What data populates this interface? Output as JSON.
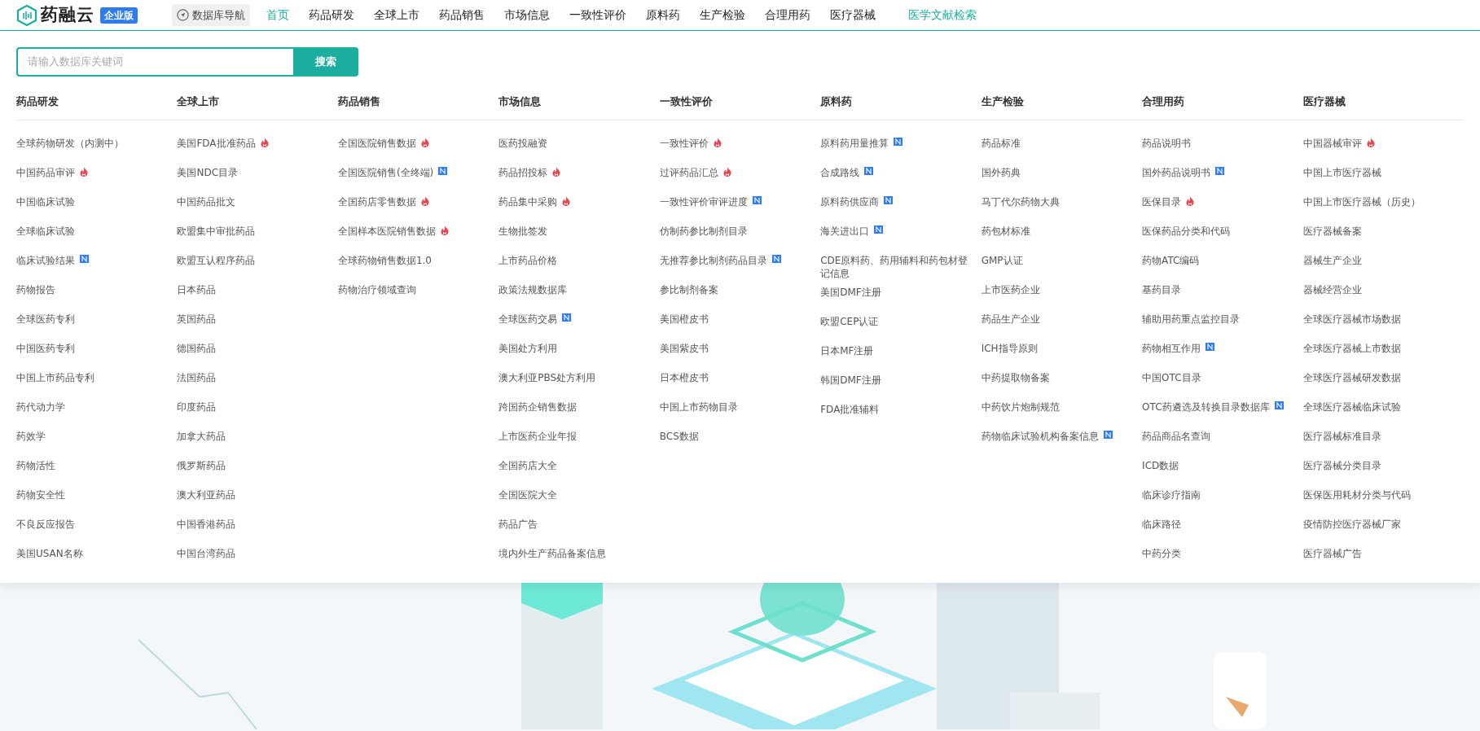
{
  "header": {
    "logo_text": "药融云",
    "edition_badge": "企业版",
    "db_nav_button": "数据库导航",
    "nav": [
      {
        "label": "首页",
        "selected": true
      },
      {
        "label": "药品研发",
        "selected": false
      },
      {
        "label": "全球上市",
        "selected": false
      },
      {
        "label": "药品销售",
        "selected": false
      },
      {
        "label": "市场信息",
        "selected": false
      },
      {
        "label": "一致性评价",
        "selected": false
      },
      {
        "label": "原料药",
        "selected": false
      },
      {
        "label": "生产检验",
        "selected": false
      },
      {
        "label": "合理用药",
        "selected": false
      },
      {
        "label": "医疗器械",
        "selected": false
      }
    ],
    "literature_link": "医学文献检索"
  },
  "search": {
    "placeholder": "请输入数据库关键词",
    "button": "搜索"
  },
  "menu": [
    {
      "title": "药品研发",
      "items": [
        {
          "label": "全球药物研发（内测中）",
          "kind": "plain"
        },
        {
          "label": "中国药品审评",
          "kind": "hot"
        },
        {
          "label": "中国临床试验",
          "kind": "plain"
        },
        {
          "label": "全球临床试验",
          "kind": "plain"
        },
        {
          "label": "临床试验结果",
          "kind": "new"
        },
        {
          "label": "药物报告",
          "kind": "plain"
        },
        {
          "label": "全球医药专利",
          "kind": "plain"
        },
        {
          "label": "中国医药专利",
          "kind": "plain"
        },
        {
          "label": "中国上市药品专利",
          "kind": "plain"
        },
        {
          "label": "药代动力学",
          "kind": "plain"
        },
        {
          "label": "药效学",
          "kind": "plain"
        },
        {
          "label": "药物活性",
          "kind": "plain"
        },
        {
          "label": "药物安全性",
          "kind": "plain"
        },
        {
          "label": "不良反应报告",
          "kind": "plain"
        },
        {
          "label": "美国USAN名称",
          "kind": "plain"
        }
      ]
    },
    {
      "title": "全球上市",
      "items": [
        {
          "label": "美国FDA批准药品",
          "kind": "hot"
        },
        {
          "label": "美国NDC目录",
          "kind": "plain"
        },
        {
          "label": "中国药品批文",
          "kind": "plain"
        },
        {
          "label": "欧盟集中审批药品",
          "kind": "plain"
        },
        {
          "label": "欧盟互认程序药品",
          "kind": "plain"
        },
        {
          "label": "日本药品",
          "kind": "plain"
        },
        {
          "label": "英国药品",
          "kind": "plain"
        },
        {
          "label": "德国药品",
          "kind": "plain"
        },
        {
          "label": "法国药品",
          "kind": "plain"
        },
        {
          "label": "印度药品",
          "kind": "plain"
        },
        {
          "label": "加拿大药品",
          "kind": "plain"
        },
        {
          "label": "俄罗斯药品",
          "kind": "plain"
        },
        {
          "label": "澳大利亚药品",
          "kind": "plain"
        },
        {
          "label": "中国香港药品",
          "kind": "plain"
        },
        {
          "label": "中国台湾药品",
          "kind": "plain"
        }
      ]
    },
    {
      "title": "药品销售",
      "items": [
        {
          "label": "全国医院销售数据",
          "kind": "hot"
        },
        {
          "label": "全国医院销售(全终端)",
          "kind": "new"
        },
        {
          "label": "全国药店零售数据",
          "kind": "hot"
        },
        {
          "label": "全国样本医院销售数据",
          "kind": "hot"
        },
        {
          "label": "全球药物销售数据1.0",
          "kind": "plain"
        },
        {
          "label": "药物治疗领域查询",
          "kind": "plain"
        }
      ]
    },
    {
      "title": "市场信息",
      "items": [
        {
          "label": "医药投融资",
          "kind": "plain"
        },
        {
          "label": "药品招投标",
          "kind": "hot"
        },
        {
          "label": "药品集中采购",
          "kind": "hot"
        },
        {
          "label": "生物批签发",
          "kind": "plain"
        },
        {
          "label": "上市药品价格",
          "kind": "plain"
        },
        {
          "label": "政策法规数据库",
          "kind": "plain"
        },
        {
          "label": "全球医药交易",
          "kind": "new"
        },
        {
          "label": "美国处方利用",
          "kind": "plain"
        },
        {
          "label": "澳大利亚PBS处方利用",
          "kind": "plain"
        },
        {
          "label": "跨国药企销售数据",
          "kind": "plain"
        },
        {
          "label": "上市医药企业年报",
          "kind": "plain"
        },
        {
          "label": "全国药店大全",
          "kind": "plain"
        },
        {
          "label": "全国医院大全",
          "kind": "plain"
        },
        {
          "label": "药品广告",
          "kind": "plain"
        },
        {
          "label": "境内外生产药品备案信息",
          "kind": "plain"
        }
      ]
    },
    {
      "title": "一致性评价",
      "items": [
        {
          "label": "一致性评价",
          "kind": "hot"
        },
        {
          "label": "过评药品汇总",
          "kind": "hot"
        },
        {
          "label": "一致性评价审评进度",
          "kind": "new"
        },
        {
          "label": "仿制药参比制剂目录",
          "kind": "plain"
        },
        {
          "label": "无推荐参比制剂药品目录",
          "kind": "new"
        },
        {
          "label": "参比制剂备案",
          "kind": "plain"
        },
        {
          "label": "美国橙皮书",
          "kind": "plain"
        },
        {
          "label": "美国紫皮书",
          "kind": "plain"
        },
        {
          "label": "日本橙皮书",
          "kind": "plain"
        },
        {
          "label": "中国上市药物目录",
          "kind": "plain"
        },
        {
          "label": "BCS数据",
          "kind": "plain"
        }
      ]
    },
    {
      "title": "原料药",
      "items": [
        {
          "label": "原料药用量推算",
          "kind": "new"
        },
        {
          "label": "合成路线",
          "kind": "new"
        },
        {
          "label": "原料药供应商",
          "kind": "new"
        },
        {
          "label": "海关进出口",
          "kind": "new"
        },
        {
          "label": "CDE原料药、药用辅料和药包材登记信息",
          "kind": "plain"
        },
        {
          "label": "美国DMF注册",
          "kind": "plain"
        },
        {
          "label": "欧盟CEP认证",
          "kind": "plain"
        },
        {
          "label": "日本MF注册",
          "kind": "plain"
        },
        {
          "label": "韩国DMF注册",
          "kind": "plain"
        },
        {
          "label": "FDA批准辅料",
          "kind": "plain"
        }
      ]
    },
    {
      "title": "生产检验",
      "items": [
        {
          "label": "药品标准",
          "kind": "plain"
        },
        {
          "label": "国外药典",
          "kind": "plain"
        },
        {
          "label": "马丁代尔药物大典",
          "kind": "plain"
        },
        {
          "label": "药包材标准",
          "kind": "plain"
        },
        {
          "label": "GMP认证",
          "kind": "plain"
        },
        {
          "label": "上市医药企业",
          "kind": "plain"
        },
        {
          "label": "药品生产企业",
          "kind": "plain"
        },
        {
          "label": "ICH指导原则",
          "kind": "plain"
        },
        {
          "label": "中药提取物备案",
          "kind": "plain"
        },
        {
          "label": "中药饮片炮制规范",
          "kind": "plain"
        },
        {
          "label": "药物临床试验机构备案信息",
          "kind": "new"
        }
      ]
    },
    {
      "title": "合理用药",
      "items": [
        {
          "label": "药品说明书",
          "kind": "plain"
        },
        {
          "label": "国外药品说明书",
          "kind": "new"
        },
        {
          "label": "医保目录",
          "kind": "hot"
        },
        {
          "label": "医保药品分类和代码",
          "kind": "plain"
        },
        {
          "label": "药物ATC编码",
          "kind": "plain"
        },
        {
          "label": "基药目录",
          "kind": "plain"
        },
        {
          "label": "辅助用药重点监控目录",
          "kind": "plain"
        },
        {
          "label": "药物相互作用",
          "kind": "new"
        },
        {
          "label": "中国OTC目录",
          "kind": "plain"
        },
        {
          "label": "OTC药遴选及转换目录数据库",
          "kind": "new"
        },
        {
          "label": "药品商品名查询",
          "kind": "plain"
        },
        {
          "label": "ICD数据",
          "kind": "plain"
        },
        {
          "label": "临床诊疗指南",
          "kind": "plain"
        },
        {
          "label": "临床路径",
          "kind": "plain"
        },
        {
          "label": "中药分类",
          "kind": "plain"
        }
      ]
    },
    {
      "title": "医疗器械",
      "items": [
        {
          "label": "中国器械审评",
          "kind": "hot"
        },
        {
          "label": "中国上市医疗器械",
          "kind": "plain"
        },
        {
          "label": "中国上市医疗器械（历史）",
          "kind": "plain"
        },
        {
          "label": "医疗器械备案",
          "kind": "plain"
        },
        {
          "label": "器械生产企业",
          "kind": "plain"
        },
        {
          "label": "器械经营企业",
          "kind": "plain"
        },
        {
          "label": "全球医疗器械市场数据",
          "kind": "plain"
        },
        {
          "label": "全球医疗器械上市数据",
          "kind": "plain"
        },
        {
          "label": "全球医疗器械研发数据",
          "kind": "plain"
        },
        {
          "label": "全球医疗器械临床试验",
          "kind": "plain"
        },
        {
          "label": "医疗器械标准目录",
          "kind": "plain"
        },
        {
          "label": "医疗器械分类目录",
          "kind": "plain"
        },
        {
          "label": "医保医用耗材分类与代码",
          "kind": "plain"
        },
        {
          "label": "疫情防控医疗器械厂家",
          "kind": "plain"
        },
        {
          "label": "医疗器械广告",
          "kind": "plain"
        }
      ]
    }
  ]
}
